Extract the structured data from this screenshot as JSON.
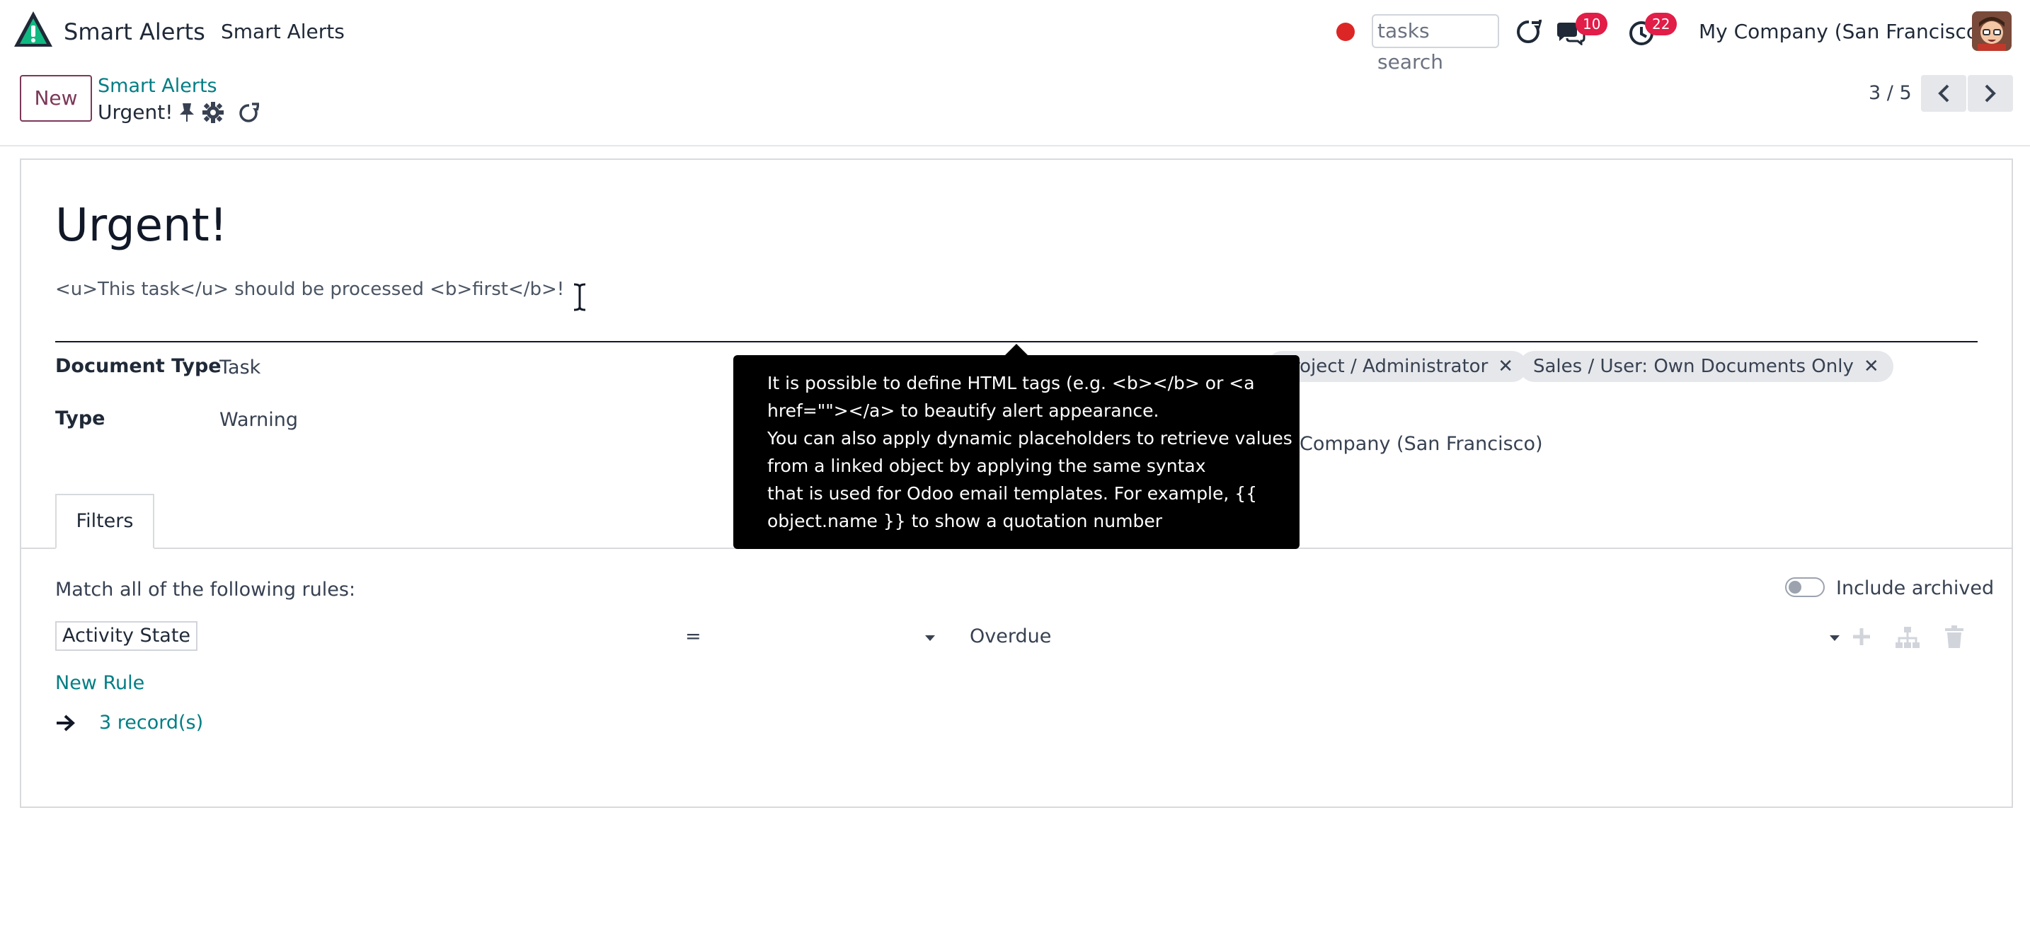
{
  "navbar": {
    "app_name": "Smart Alerts",
    "menu_item": "Smart Alerts",
    "search_value": "tasks search",
    "messages_count": "10",
    "activities_count": "22",
    "company": "My Company (San Francisco)"
  },
  "control_panel": {
    "new_label": "New",
    "breadcrumb_parent": "Smart Alerts",
    "breadcrumb_current": "Urgent!",
    "pager": "3 / 5"
  },
  "form": {
    "title": "Urgent!",
    "message": "<u>This task</u> should be processed <b>first</b>!",
    "document_type_label": "Document Type",
    "document_type_value": "Task",
    "type_label": "Type",
    "type_value": "Warning",
    "groups": [
      "roject / Administrator",
      "Sales / User: Own Documents Only"
    ],
    "company_value": " Company (San Francisco)"
  },
  "tabs": [
    "Filters"
  ],
  "filters": {
    "match_text": "Match all of the following rules:",
    "include_archived": "Include archived",
    "rule": {
      "field": "Activity State",
      "operator": "=",
      "value": "Overdue"
    },
    "new_rule": "New Rule",
    "records": "3 record(s)"
  },
  "tooltip": {
    "lines": [
      "It is possible to define HTML tags (e.g. <b></b> or <a",
      "href=\"\"></a> to beautify alert appearance.",
      "You can also apply dynamic placeholders to retrieve values",
      "from a linked object by applying the same syntax",
      "that is used for Odoo email templates. For example, {{",
      "object.name }} to show a quotation number"
    ]
  },
  "colors": {
    "brand": "#7c3858",
    "link": "#017e84",
    "badge": "#e11d48",
    "record_dot": "#dc2626"
  }
}
